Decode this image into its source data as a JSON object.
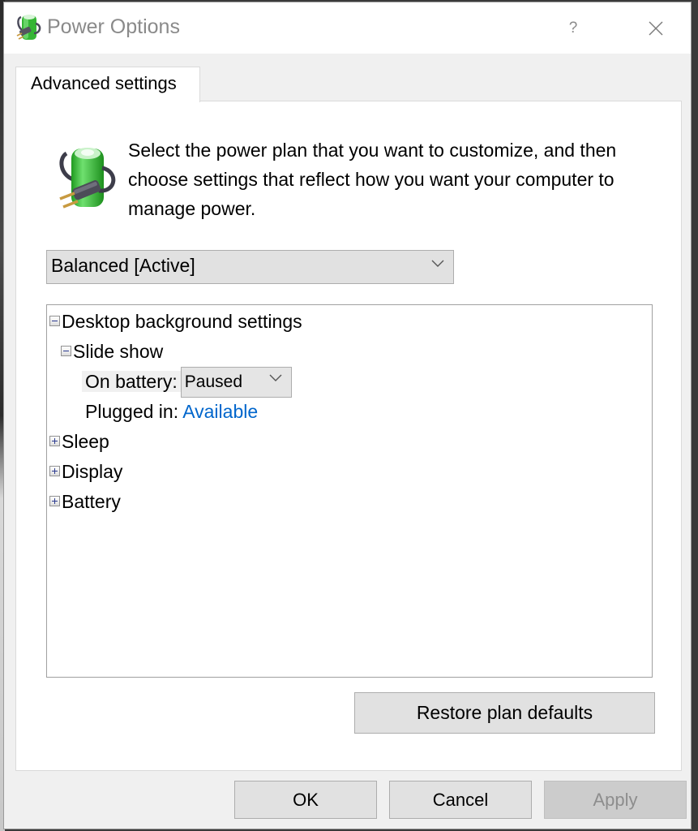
{
  "window": {
    "title": "Power Options",
    "title_icon": "power-plug-battery-icon",
    "help_label": "?",
    "close_icon": "close-icon"
  },
  "tabs": [
    {
      "label": "Advanced settings",
      "selected": true
    }
  ],
  "intro": {
    "icon": "power-plug-battery-icon",
    "text": "Select the power plan that you want to customize, and then choose settings that reflect how you want your computer to manage power."
  },
  "plan_select": {
    "value": "Balanced [Active]",
    "icon": "chevron-down-icon"
  },
  "tree": {
    "nodes": [
      {
        "label": "Desktop background settings",
        "expanded": true,
        "level": 0
      },
      {
        "label": "Slide show",
        "expanded": true,
        "level": 1
      },
      {
        "label": "On battery:",
        "value": "Paused",
        "level": 2,
        "editor": "dropdown"
      },
      {
        "label": "Plugged in:",
        "value": "Available",
        "level": 2,
        "editor": "link"
      },
      {
        "label": "Sleep",
        "expanded": false,
        "level": 0
      },
      {
        "label": "Display",
        "expanded": false,
        "level": 0
      },
      {
        "label": "Battery",
        "expanded": false,
        "level": 0
      }
    ]
  },
  "buttons": {
    "restore": "Restore plan defaults",
    "ok": "OK",
    "cancel": "Cancel",
    "apply": "Apply",
    "apply_enabled": false
  },
  "colors": {
    "link": "#0066cc",
    "battery_green": "#3cc43c"
  }
}
